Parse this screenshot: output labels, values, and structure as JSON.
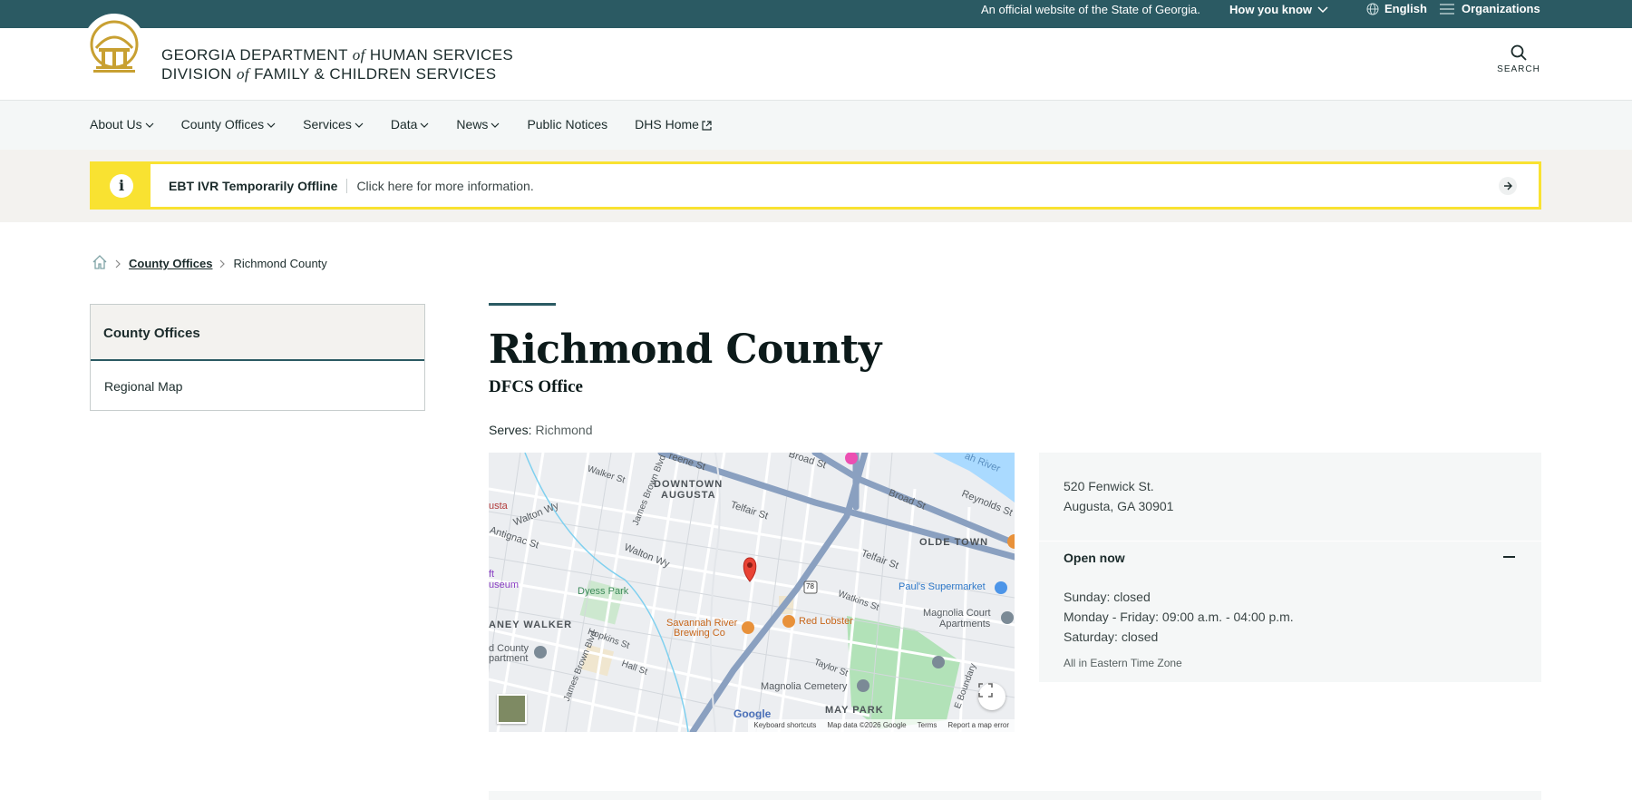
{
  "topbar": {
    "official": "An official website of the State of Georgia.",
    "how_you_know": "How you know",
    "language": "English",
    "organizations": "Organizations"
  },
  "header": {
    "line1_pre": "GEORGIA DEPARTMENT ",
    "line1_of": "of",
    "line1_post": " HUMAN SERVICES",
    "line2_pre": "DIVISION ",
    "line2_of": "of",
    "line2_post": " FAMILY & CHILDREN SERVICES",
    "search_label": "SEARCH"
  },
  "nav": {
    "items": [
      {
        "label": "About Us"
      },
      {
        "label": "County Offices"
      },
      {
        "label": "Services"
      },
      {
        "label": "Data"
      },
      {
        "label": "News"
      },
      {
        "label": "Public Notices"
      },
      {
        "label": "DHS Home"
      }
    ]
  },
  "alert": {
    "title": "EBT IVR Temporarily Offline",
    "message": "Click here for more information."
  },
  "breadcrumb": {
    "link": "County Offices",
    "current": "Richmond County"
  },
  "sidebar": {
    "heading": "County Offices",
    "items": [
      {
        "label": "Regional Map"
      }
    ]
  },
  "main": {
    "title": "Richmond County",
    "subtitle": "DFCS Office",
    "serves_label": "Serves:",
    "serves_value": "Richmond"
  },
  "map": {
    "labels": {
      "downtown1": "DOWNTOWN",
      "downtown2": "AUGUSTA",
      "olde_town": "OLDE TOWN",
      "laney_walker": "ANEY WALKER",
      "may_park": "MAY PARK",
      "dyess_park": "Dyess Park",
      "savannah1": "Savannah River",
      "savannah2": "Brewing Co",
      "red_lobster": "Red Lobster",
      "pauls": "Paul's Supermarket",
      "magnolia_court1": "Magnolia Court",
      "magnolia_court2": "Apartments",
      "magnolia_cem": "Magnolia Cemetery",
      "county1": "d County",
      "county2": "partment",
      "museum1": "ft",
      "museum2": "useum",
      "usta": "usta",
      "river": "ah River",
      "greene": "reene St",
      "broad1": "Broad St",
      "broad2": "Broad St",
      "reynolds": "Reynolds St",
      "walker": "Walker St",
      "walton1": "Walton Wy",
      "walton2": "Walton Wy",
      "telfair1": "Telfair St",
      "telfair2": "Telfair St",
      "antignac": "Antignac St",
      "james_brown1": "James Brown Blvd",
      "james_brown2": "James Brown Blvd",
      "watkins": "Watkins St",
      "taylor": "Taylor St",
      "hall": "Hall St",
      "hopkins": "Hopkins St",
      "e_boundary": "E Boundary",
      "route": "78",
      "google": "Google"
    },
    "footer": {
      "shortcuts": "Keyboard shortcuts",
      "mapdata": "Map data ©2026 Google",
      "terms": "Terms",
      "report": "Report a map error"
    }
  },
  "office": {
    "address_line1": "520 Fenwick St.",
    "address_line2": "Augusta, GA 30901",
    "status": "Open now",
    "hours": [
      "Sunday: closed",
      "Monday - Friday: 09:00 a.m. - 04:00 p.m.",
      "Saturday: closed"
    ],
    "timezone": "All in Eastern Time Zone"
  },
  "colors": {
    "topbar": "#2b5a63",
    "alert_yellow": "#f9e231",
    "accent": "#2b5a63"
  }
}
